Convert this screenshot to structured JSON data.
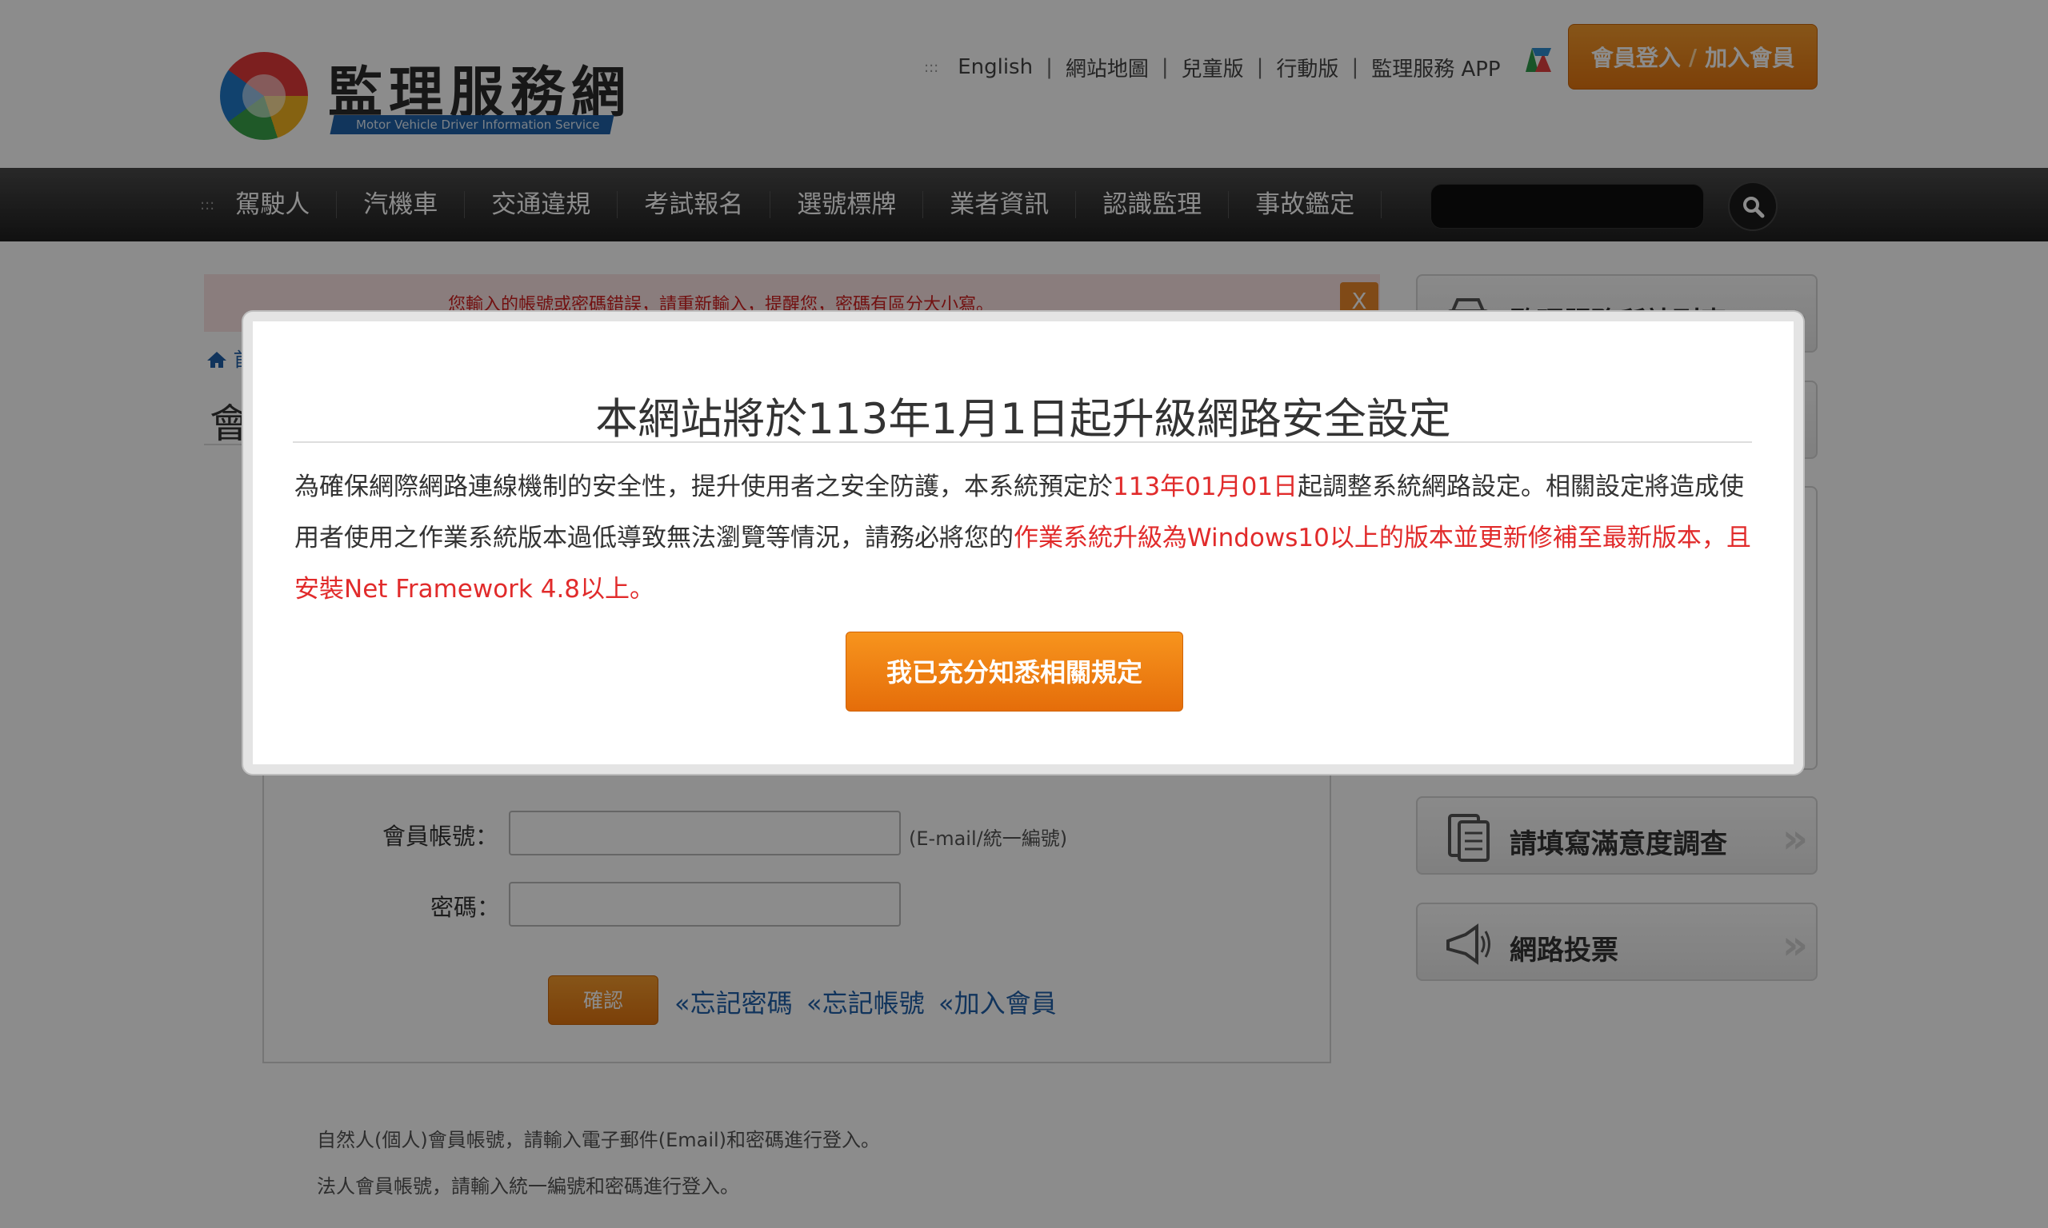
{
  "header": {
    "logo_title": "監理服務網",
    "logo_subtitle": "Motor Vehicle Driver Information Service",
    "top_links": [
      "English",
      "網站地圖",
      "兒童版",
      "行動版",
      "監理服務 APP"
    ],
    "top_links_dots": ":::",
    "login_label": "會員登入",
    "login_sep": "/",
    "register_label": "加入會員"
  },
  "nav": {
    "dots": ":::",
    "items": [
      "駕駛人",
      "汽機車",
      "交通違規",
      "考試報名",
      "選號標牌",
      "業者資訊",
      "認識監理",
      "事故鑑定"
    ]
  },
  "main": {
    "alert_text": "您輸入的帳號或密碼錯誤，請重新輸入，提醒您，密碼有區分大小寫。",
    "alert_close": "X",
    "breadcrumb": "首",
    "page_title": "會",
    "form": {
      "account_label": "會員帳號：",
      "account_hint": "(E-mail/統一編號)",
      "password_label": "密碼：",
      "confirm_label": "確認",
      "links": [
        "«忘記密碼",
        "«忘記帳號",
        "«加入會員"
      ]
    },
    "notes": [
      "自然人(個人)會員帳號，請輸入電子郵件(Email)和密碼進行登入。",
      "法人會員帳號，請輸入統一編號和密碼進行登入。"
    ]
  },
  "sidebar": {
    "top_item_label": "監理服務所站列表",
    "survey_label": "請填寫滿意度調查",
    "vote_label": "網路投票",
    "chevron": "»"
  },
  "modal": {
    "title": "本網站將於113年1月1日起升級網路安全設定",
    "body_1": "為確保網際網路連線機制的安全性，提升使用者之安全防護，本系統預定於",
    "body_date": "113年01月01日",
    "body_2": "起調整系統網路設定。相關設定將造成使用者使用之作業系統版本過低導致無法瀏覽等情況，請務必將您的",
    "body_red": "作業系統升級為Windows10以上的版本並更新修補至最新版本，且安裝Net Framework 4.8以上",
    "body_end": "。",
    "ack_label": "我已充分知悉相關規定"
  },
  "colors": {
    "accent_orange": "#f08a1f",
    "warning_red": "#e12b2b",
    "link_blue": "#1f5fa8",
    "nav_dark": "#2a2a2a"
  },
  "icons": {
    "search": "search-icon",
    "lang": "language-icon",
    "home": "home-icon",
    "survey": "document-icon",
    "vote": "megaphone-icon"
  }
}
